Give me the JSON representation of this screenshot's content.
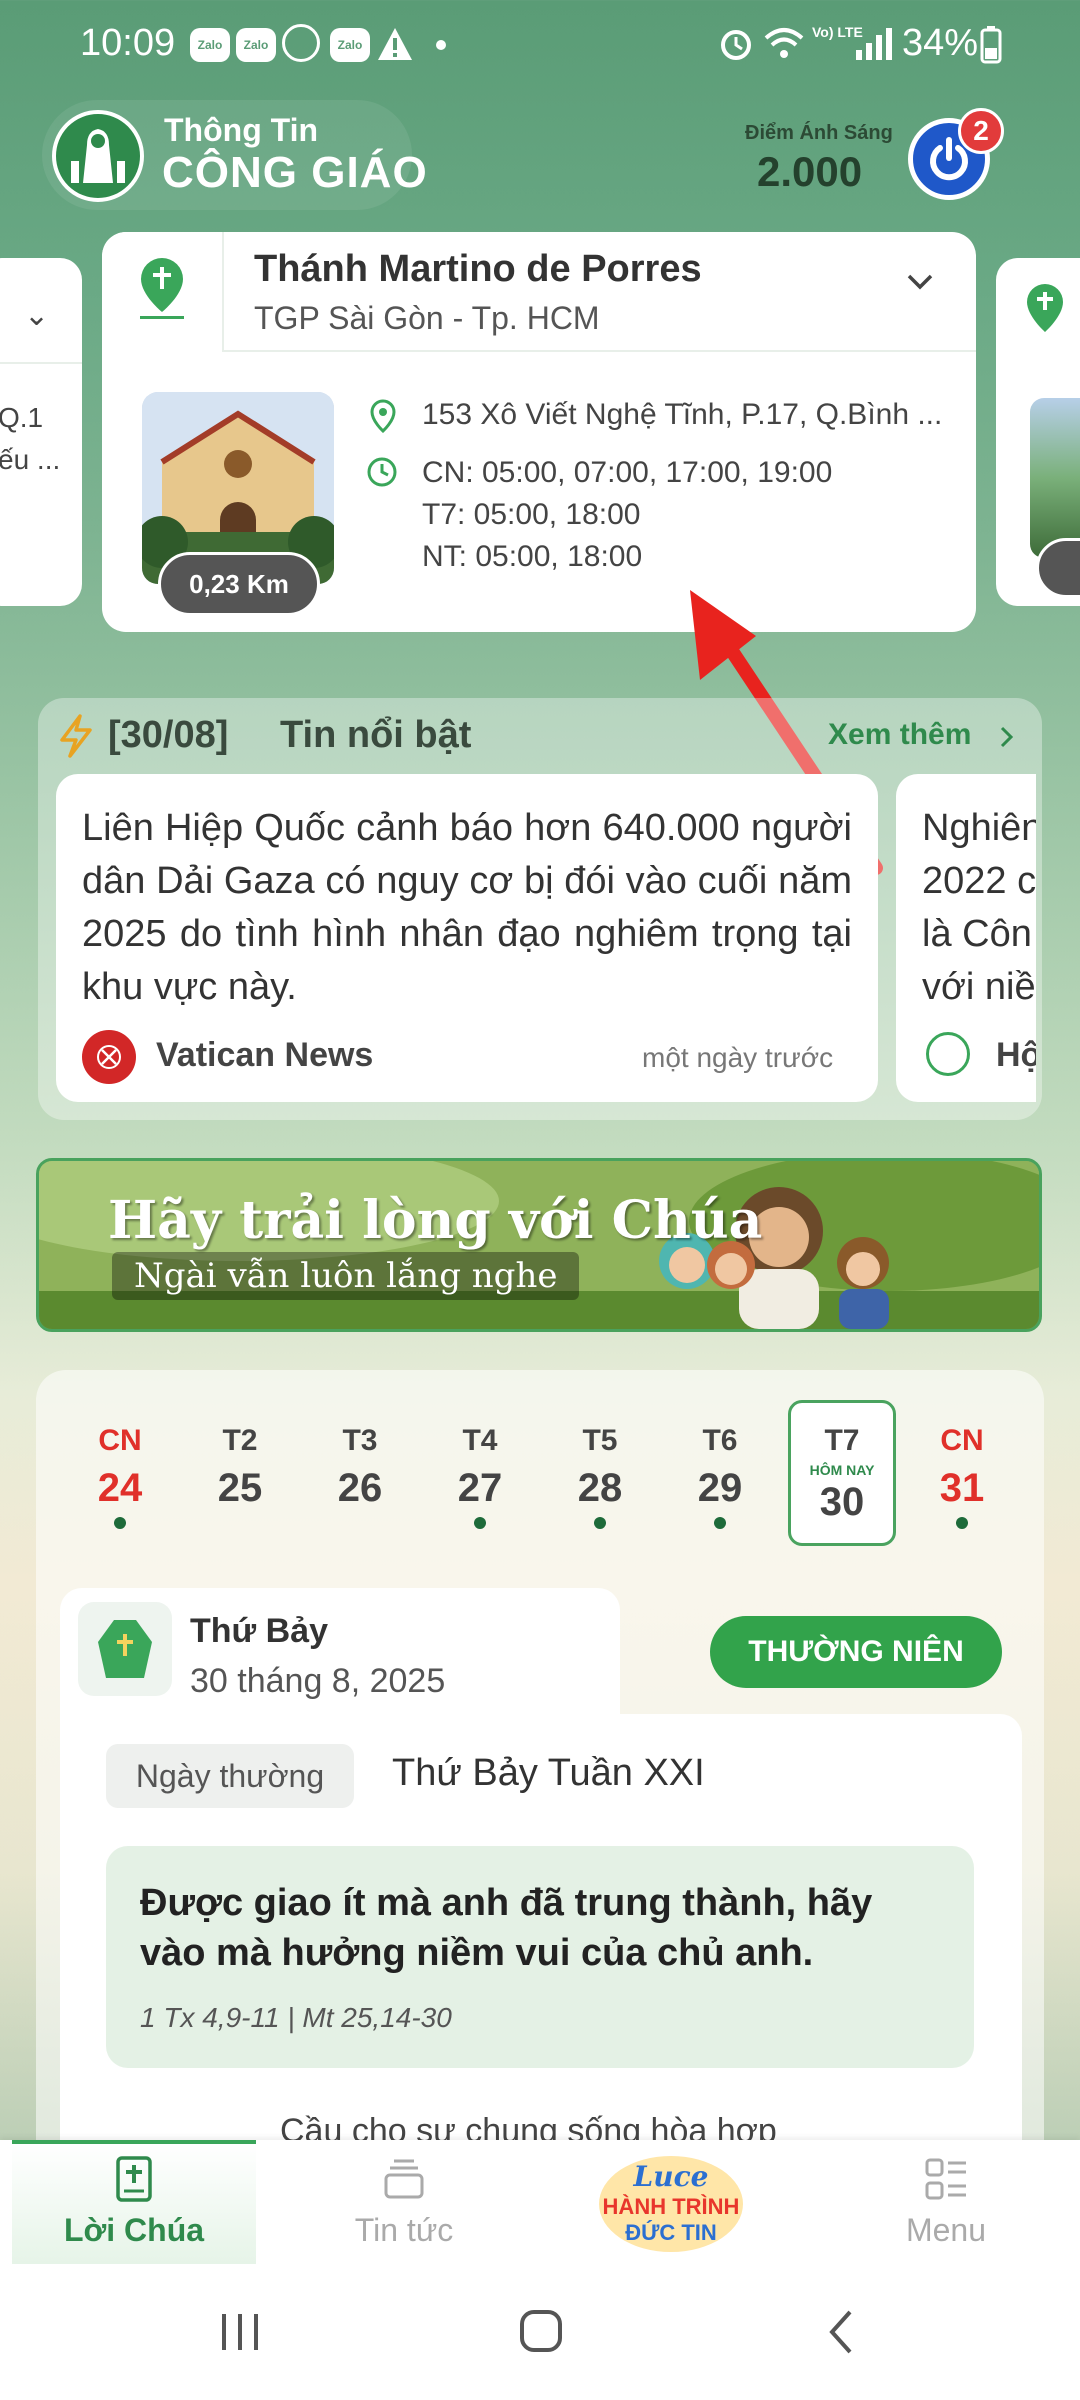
{
  "status_bar": {
    "time": "10:09",
    "notifications": [
      "Zalo",
      "Zalo",
      "Zalo"
    ],
    "battery": "34%",
    "network": "Vo) LTE"
  },
  "header": {
    "brand_line1": "Thông Tin",
    "brand_line2": "CÔNG GIÁO",
    "points_label": "Điểm Ánh Sáng",
    "points_value": "2.000",
    "notification_count": "2"
  },
  "church": {
    "name": "Thánh Martino de Porres",
    "diocese": "TGP Sài Gòn - Tp. HCM",
    "address": "153 Xô Viết Nghệ Tĩnh, P.17, Q.Bình ...",
    "schedule_sunday": "CN: 05:00, 07:00, 17:00, 19:00",
    "schedule_saturday": "T7: 05:00, 18:00",
    "schedule_weekday": "NT: 05:00, 18:00",
    "distance": "0,23 Km",
    "side_left_text": [
      "Q.1",
      "ếu ..."
    ]
  },
  "news": {
    "date": "[30/08]",
    "title": "Tin nổi bật",
    "more_label": "Xem thêm",
    "items": [
      {
        "text": "Liên Hiệp Quốc cảnh báo hơn 640.000 người dân Dải Gaza có nguy cơ bị đói vào cuối năm 2025 do tình hình nhân đạo nghiêm trọng tại khu vực này.",
        "source": "Vatican News",
        "time": "một ngày trước"
      },
      {
        "text_lines": [
          "Nghiên",
          "2022 c",
          "là Côn",
          "với niề"
        ],
        "source": "Hộ"
      }
    ]
  },
  "banner": {
    "line1": "Hãy trải lòng với Chúa",
    "line2": "Ngài vẫn luôn lắng nghe"
  },
  "calendar": {
    "today_tag": "HÔM NAY",
    "days": [
      {
        "dw": "CN",
        "dn": "24"
      },
      {
        "dw": "T2",
        "dn": "25"
      },
      {
        "dw": "T3",
        "dn": "26"
      },
      {
        "dw": "T4",
        "dn": "27"
      },
      {
        "dw": "T5",
        "dn": "28"
      },
      {
        "dw": "T6",
        "dn": "29"
      },
      {
        "dw": "T7",
        "dn": "30"
      },
      {
        "dw": "CN",
        "dn": "31"
      }
    ]
  },
  "liturgy": {
    "day_name": "Thứ Bảy",
    "day_date": "30 tháng 8, 2025",
    "season": "THƯỜNG NIÊN",
    "day_type": "Ngày thường",
    "week_title": "Thứ Bảy Tuần XXI",
    "verse": "Được giao ít mà anh đã trung thành, hãy vào mà hưởng niềm vui của chủ anh.",
    "reference": "1 Tx 4,9-11 | Mt 25,14-30",
    "prayer": "Cầu cho sự chung sống hòa hợp"
  },
  "bottom_nav": {
    "items": [
      "Lời Chúa",
      "Tin tức",
      "Menu"
    ],
    "luce_logo": [
      "Luce",
      "HÀNH TRÌNH",
      "ĐỨC TIN"
    ]
  },
  "colors": {
    "brand_green": "#2f8a4c",
    "accent_red": "#e0302a",
    "season_green": "#32a34b",
    "power_blue": "#1f58c9"
  }
}
